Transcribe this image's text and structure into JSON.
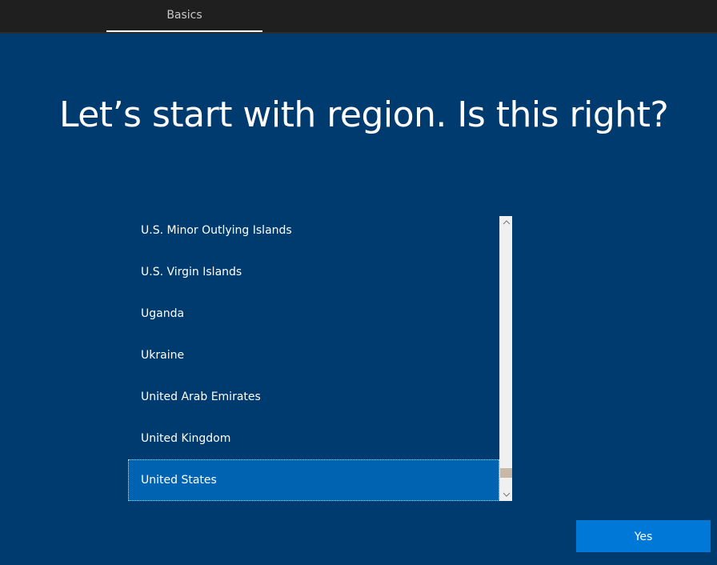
{
  "header": {
    "tab_label": "Basics"
  },
  "main": {
    "title": "Let’s start with region. Is this right?"
  },
  "region_list": {
    "items": [
      "U.S. Minor Outlying Islands",
      "U.S. Virgin Islands",
      "Uganda",
      "Ukraine",
      "United Arab Emirates",
      "United Kingdom",
      "United States"
    ],
    "selected": "United States",
    "scroll_up_icon": "chevron-up-icon",
    "scroll_down_icon": "chevron-down-icon"
  },
  "footer": {
    "yes_label": "Yes"
  },
  "colors": {
    "background": "#003b6f",
    "topbar": "#1f1f1f",
    "selected_item": "#0063b1",
    "accent_button": "#0078d7"
  }
}
